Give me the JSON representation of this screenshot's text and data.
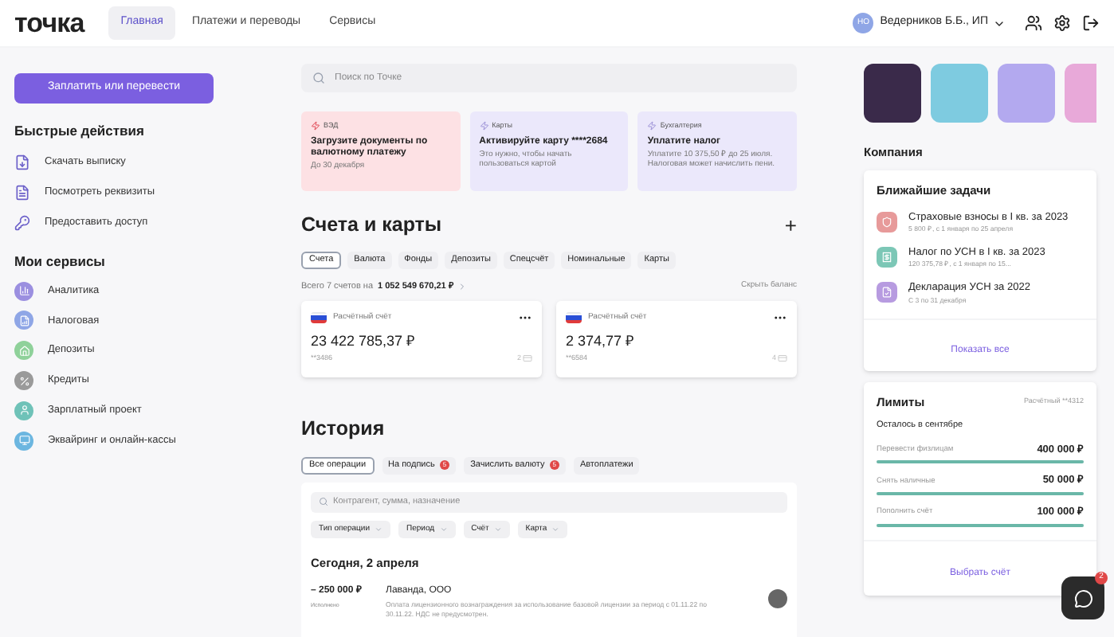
{
  "header": {
    "logo": "точка",
    "nav": [
      {
        "label": "Главная",
        "selected": true
      },
      {
        "label": "Платежи и переводы",
        "selected": false
      },
      {
        "label": "Сервисы",
        "selected": false
      }
    ],
    "user": {
      "initials": "НО",
      "name": "Ведерников Б.Б., ИП"
    }
  },
  "sidebar": {
    "pay_button": "Заплатить или перевести",
    "quick_title": "Быстрые действия",
    "quick_actions": [
      {
        "label": "Скачать выписку",
        "kind": "download"
      },
      {
        "label": "Посмотреть реквизиты",
        "kind": "details"
      },
      {
        "label": "Предоставить доступ",
        "kind": "key"
      }
    ],
    "services_title": "Мои сервисы",
    "services": [
      {
        "label": "Аналитика",
        "color": "#9b8fe0"
      },
      {
        "label": "Налоговая",
        "color": "#8fa6e6"
      },
      {
        "label": "Депозиты",
        "color": "#8fd19a"
      },
      {
        "label": "Кредиты",
        "color": "#9a9a9a"
      },
      {
        "label": "Зарплатный проект",
        "color": "#6fc2b8"
      },
      {
        "label": "Эквайринг и онлайн-кассы",
        "color": "#6cb6e0"
      }
    ]
  },
  "search": {
    "placeholder": "Поиск по Точке"
  },
  "notices": [
    {
      "tag": "ВЭД",
      "title": "Загрузите документы по валютному платежу",
      "text": "До 30 декабря",
      "kind": "urgent"
    },
    {
      "tag": "Карты",
      "title": "Активируйте карту ****2684",
      "text": "Это нужно, чтобы начать пользоваться картой",
      "kind": "info"
    },
    {
      "tag": "Бухгалтерия",
      "title": "Уплатите налог",
      "text": "Уплатите 10 375,50 ₽ до 25 июля. Налоговая может начислить пени.",
      "kind": "info"
    }
  ],
  "accounts": {
    "title": "Счета и карты",
    "add": "+",
    "tabs": [
      {
        "label": "Счета",
        "selected": true
      },
      {
        "label": "Валюта",
        "selected": false
      },
      {
        "label": "Фонды",
        "selected": false
      },
      {
        "label": "Депозиты",
        "selected": false
      },
      {
        "label": "Спецсчёт",
        "selected": false
      },
      {
        "label": "Номинальные",
        "selected": false
      },
      {
        "label": "Карты",
        "selected": false
      }
    ],
    "total_prefix": "Всего 7 счетов на",
    "total": "1 052 549 670,21 ₽",
    "hide": "Скрыть баланс",
    "cards": [
      {
        "type": "Расчётный счёт",
        "balance": "23 422 785,37 ₽",
        "number": "**3486",
        "card_count": "2"
      },
      {
        "type": "Расчётный счёт",
        "balance": "2 374,77 ₽",
        "number": "**6584",
        "card_count": "4"
      }
    ]
  },
  "history": {
    "title": "История",
    "tabs": [
      {
        "label": "Все операции",
        "selected": true
      },
      {
        "label": "На подпись",
        "badge": "5",
        "selected": false
      },
      {
        "label": "Зачислить валюту",
        "badge": "5",
        "selected": false
      },
      {
        "label": "Автоплатежи",
        "selected": false
      }
    ],
    "search_placeholder": "Контрагент, сумма, назначение",
    "filters": [
      "Тип операции",
      "Период",
      "Счёт",
      "Карта"
    ],
    "date": "Сегодня, 2 апреля",
    "operations": [
      {
        "amount": "– 250 000 ₽",
        "status": "Исполнено",
        "counterparty": "Лаванда, ООО",
        "purpose": "Оплата лицензионного вознаграждения за использование базовой лицензии за период с 01.11.22 по 30.11.22. НДС не предусмотрен."
      }
    ]
  },
  "company": {
    "title": "Компания",
    "tasks": {
      "title": "Ближайшие задачи",
      "items": [
        {
          "title": "Страховые взносы в I кв. за 2023",
          "text": "5 800 ₽, с 1 января по 25 апреля",
          "color": "#e79a9a"
        },
        {
          "title": "Налог по УСН в I кв. за 2023",
          "text": "120 375,78 ₽, с 1 января по 15...",
          "color": "#7cc7b6"
        },
        {
          "title": "Декларация УСН за 2022",
          "text": "С 3 по 31 декабря",
          "color": "#b79be0"
        }
      ],
      "link": "Показать все"
    },
    "limits": {
      "title": "Лимиты",
      "account": "Расчётный **4312",
      "subtitle": "Осталось в сентябре",
      "items": [
        {
          "label": "Перевести физлицам",
          "value": "400 000 ₽",
          "level": 1
        },
        {
          "label": "Снять наличные",
          "value": "50 000 ₽",
          "level": 1
        },
        {
          "label": "Пополнить счёт",
          "value": "100 000 ₽",
          "level": 1
        }
      ],
      "link": "Выбрать счёт"
    }
  },
  "chat": {
    "badge": "2"
  }
}
